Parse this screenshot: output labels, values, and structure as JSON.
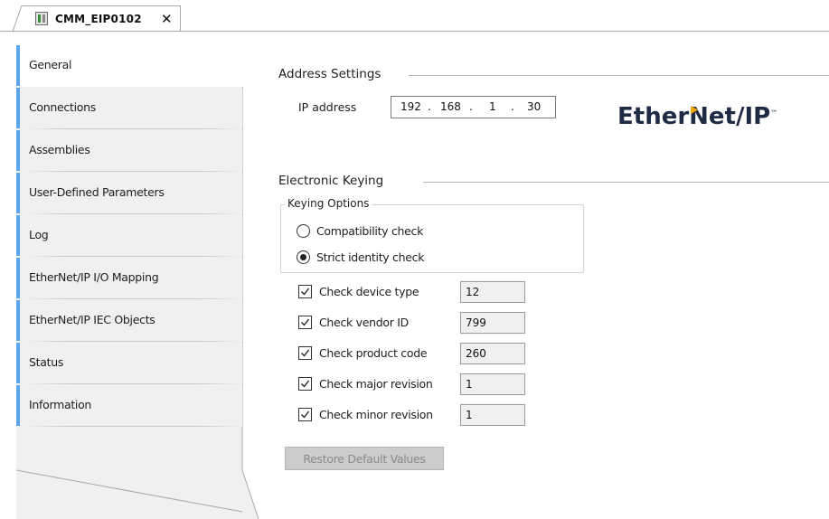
{
  "window": {
    "tab_title": "CMM_EIP0102",
    "tab_close_glyph": "✕"
  },
  "sidebar": {
    "items": [
      {
        "label": "General",
        "selected": true
      },
      {
        "label": "Connections",
        "selected": false
      },
      {
        "label": "Assemblies",
        "selected": false
      },
      {
        "label": "User-Defined Parameters",
        "selected": false
      },
      {
        "label": "Log",
        "selected": false
      },
      {
        "label": "EtherNet/IP I/O Mapping",
        "selected": false
      },
      {
        "label": "EtherNet/IP IEC Objects",
        "selected": false
      },
      {
        "label": "Status",
        "selected": false
      },
      {
        "label": "Information",
        "selected": false
      }
    ],
    "accent_color": "#5aa6e8"
  },
  "address_settings": {
    "title": "Address Settings",
    "ip_label": "IP address",
    "ip_octets": [
      "192",
      "168",
      "1",
      "30"
    ]
  },
  "logo": {
    "text_before": "Ether",
    "text_n": "N",
    "text_after": "et/IP",
    "trademark": "™",
    "flag_color": "#f0a400",
    "text_color": "#1f2a44"
  },
  "electronic_keying": {
    "title": "Electronic Keying",
    "keying_options_title": "Keying Options",
    "options": [
      {
        "label": "Compatibility check",
        "checked": false
      },
      {
        "label": "Strict identity check",
        "checked": true
      }
    ],
    "checks": [
      {
        "label": "Check device type",
        "checked": true,
        "value": "12"
      },
      {
        "label": "Check vendor ID",
        "checked": true,
        "value": "799"
      },
      {
        "label": "Check product code",
        "checked": true,
        "value": "260"
      },
      {
        "label": "Check major revision",
        "checked": true,
        "value": "1"
      },
      {
        "label": "Check minor revision",
        "checked": true,
        "value": "1"
      }
    ],
    "restore_button": "Restore Default Values"
  }
}
